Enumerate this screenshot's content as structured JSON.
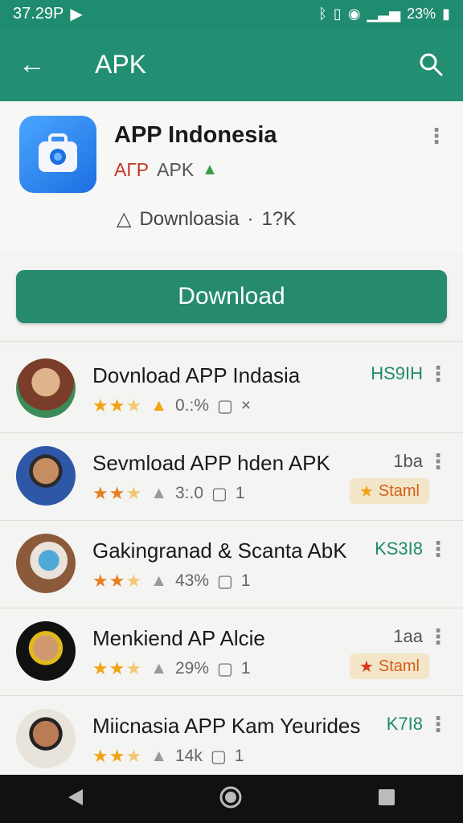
{
  "status": {
    "time": "37.29P",
    "battery": "23%"
  },
  "appbar": {
    "title": "APK"
  },
  "app": {
    "name": "APP Indonesia",
    "sub_red": "AГP",
    "sub_grey": "APK",
    "downloads_label": "Downloasia",
    "downloads_count": "1?K"
  },
  "download_button": "Download",
  "list": [
    {
      "title": "Dovnload APP Indasia",
      "right": "HS9IH",
      "count": "0.:%",
      "extra": "×"
    },
    {
      "title": "Sevmload APP hden APK",
      "right": "1ba",
      "count": "3:.0",
      "extra": "1",
      "badge": "Staml"
    },
    {
      "title": "Gakingranad & Scanta AbK",
      "right": "KS3I8",
      "count": "43%",
      "extra": "1"
    },
    {
      "title": "Menkiend AP Alcie",
      "right": "1aa",
      "count": "29%",
      "extra": "1",
      "badge": "Staml"
    },
    {
      "title": "Miicnasia APP Kam Yeurides",
      "right": "K7I8",
      "count": "14k",
      "extra": "1"
    }
  ]
}
